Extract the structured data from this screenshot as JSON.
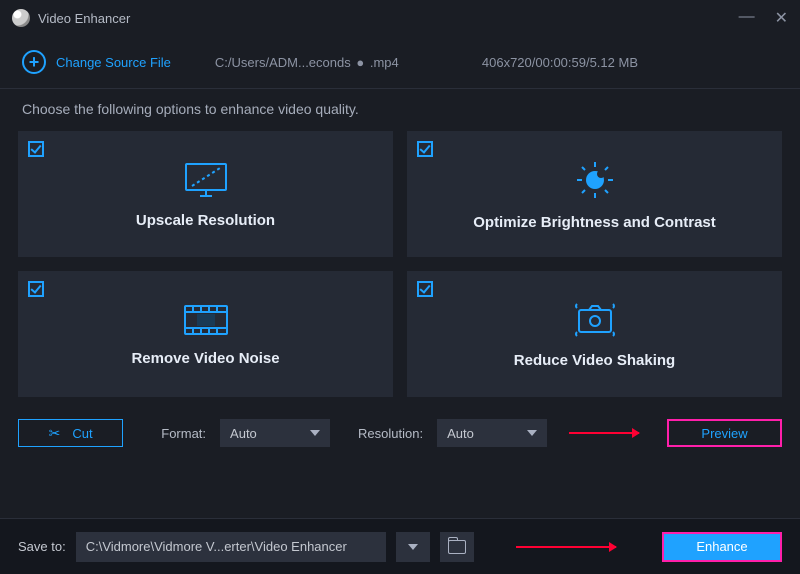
{
  "window": {
    "title": "Video Enhancer"
  },
  "header": {
    "change_source": "Change Source File",
    "path": "C:/Users/ADM...econds",
    "ext_badge": "●",
    "ext": ".mp4",
    "meta": "406x720/00:00:59/5.12 MB"
  },
  "subhead": "Choose the following options to enhance video quality.",
  "cards": {
    "upscale": "Upscale Resolution",
    "brightness": "Optimize Brightness and Contrast",
    "noise": "Remove Video Noise",
    "shake": "Reduce Video Shaking"
  },
  "controls": {
    "cut": "Cut",
    "format_label": "Format:",
    "format_value": "Auto",
    "resolution_label": "Resolution:",
    "resolution_value": "Auto",
    "preview": "Preview"
  },
  "footer": {
    "save_label": "Save to:",
    "save_path": "C:\\Vidmore\\Vidmore V...erter\\Video Enhancer",
    "enhance": "Enhance"
  }
}
